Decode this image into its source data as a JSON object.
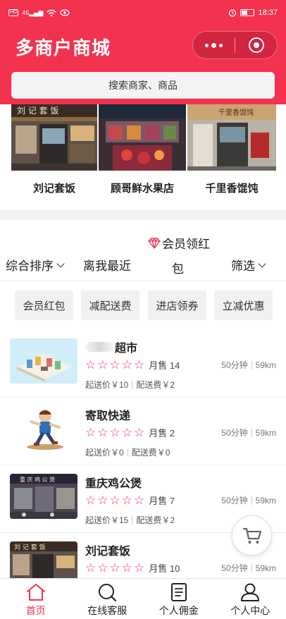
{
  "statusbar": {
    "time": "18:37",
    "hd_badge": "HD",
    "signal_badge": "46"
  },
  "header": {
    "title": "多商户商城",
    "more_icon": "more-dots-icon",
    "close_icon": "target-icon"
  },
  "search": {
    "placeholder": "搜索商家、商品"
  },
  "featured": [
    {
      "name": "刘记套饭"
    },
    {
      "name": "顾哥鲜水果店"
    },
    {
      "name": "千里香馄饨"
    }
  ],
  "sortbar": {
    "comprehensive": "综合排序",
    "nearest": "离我最近",
    "member_line1": "会员领红",
    "member_line2": "包",
    "filter": "筛选"
  },
  "chips": [
    "会员红包",
    "减配送费",
    "进店领券",
    "立减优惠"
  ],
  "stores": [
    {
      "name": "超市",
      "rating": 0,
      "sales": "月售 14",
      "time": "50分钟",
      "distance": "59km",
      "min_price": "起送价￥10",
      "delivery_fee": "配送费￥2"
    },
    {
      "name": "寄取快递",
      "rating": 0,
      "sales": "月售 2",
      "time": "50分钟",
      "distance": "59km",
      "min_price": "起送价￥0",
      "delivery_fee": "配送费￥0"
    },
    {
      "name": "重庆鸡公煲",
      "rating": 0,
      "sales": "月售 7",
      "time": "50分钟",
      "distance": "59km",
      "min_price": "起送价￥15",
      "delivery_fee": "配送费￥2"
    },
    {
      "name": "刘记套饭",
      "rating": 0,
      "sales": "月售 10",
      "time": "50分钟",
      "distance": "59km",
      "min_price": "",
      "delivery_fee": ""
    }
  ],
  "tabs": [
    {
      "label": "首页",
      "icon": "home-icon",
      "active": true
    },
    {
      "label": "在线客服",
      "icon": "search-icon",
      "active": false
    },
    {
      "label": "个人佣金",
      "icon": "document-icon",
      "active": false
    },
    {
      "label": "个人中心",
      "icon": "user-icon",
      "active": false
    }
  ],
  "colors": {
    "accent": "#f2324f",
    "chip_bg": "#f1f1f1"
  }
}
